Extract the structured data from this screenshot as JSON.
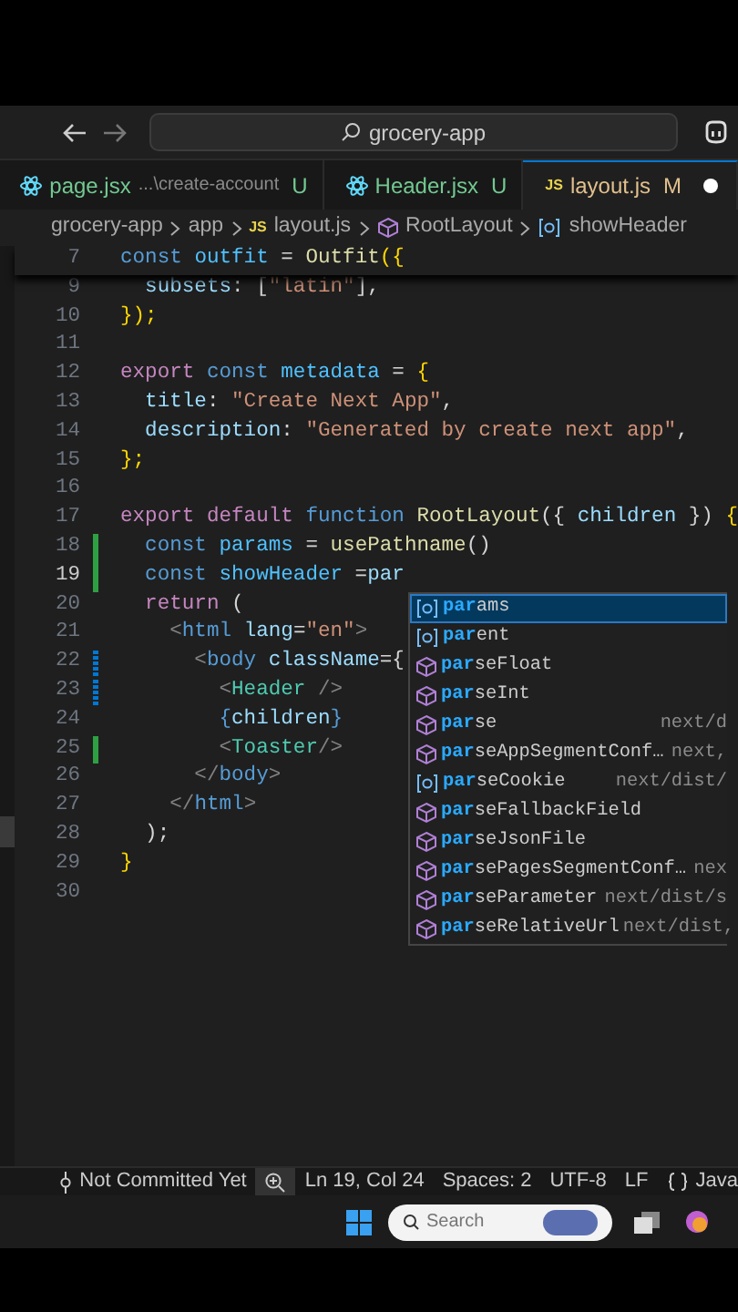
{
  "title_bar": {
    "search": "grocery-app"
  },
  "tabs": [
    {
      "label": "page.jsx",
      "path": "...\\create-account",
      "badge": "U",
      "kind": "react",
      "modified": false,
      "selected": false,
      "dirty": false
    },
    {
      "label": "Header.jsx",
      "badge": "U",
      "kind": "react",
      "modified": false,
      "selected": false,
      "dirty": false
    },
    {
      "label": "layout.js",
      "badge": "M",
      "kind": "js",
      "icon_text": "JS",
      "modified": true,
      "selected": true,
      "dirty": true
    }
  ],
  "breadcrumb": [
    {
      "label": "grocery-app",
      "kind": "folder"
    },
    {
      "label": "app",
      "kind": "folder"
    },
    {
      "label": "layout.js",
      "kind": "js",
      "icon_text": "JS"
    },
    {
      "label": "RootLayout",
      "kind": "module"
    },
    {
      "label": "showHeader",
      "kind": "variable"
    }
  ],
  "editor": {
    "sticky": {
      "number": "7",
      "tokens": [
        {
          "text": "const ",
          "kind": "kw"
        },
        {
          "text": "outfit",
          "kind": "const"
        },
        {
          "text": " = ",
          "kind": "p"
        },
        {
          "text": "Outfit",
          "kind": "fn"
        },
        {
          "text": "({",
          "kind": "br"
        }
      ]
    },
    "lines": [
      {
        "number": "9",
        "current": false,
        "added": false,
        "modified": false,
        "tokens": [
          {
            "text": "  subsets",
            "kind": "var"
          },
          {
            "text": ": [",
            "kind": "p"
          },
          {
            "text": "\"latin\"",
            "kind": "str"
          },
          {
            "text": "],",
            "kind": "p"
          }
        ]
      },
      {
        "number": "10",
        "current": false,
        "added": false,
        "modified": false,
        "tokens": [
          {
            "text": "});",
            "kind": "br"
          }
        ]
      },
      {
        "number": "11",
        "current": false,
        "added": false,
        "modified": false
      },
      {
        "number": "12",
        "current": false,
        "added": false,
        "modified": false,
        "tokens": [
          {
            "text": "export ",
            "kind": "ctl"
          },
          {
            "text": "const ",
            "kind": "kw"
          },
          {
            "text": "metadata",
            "kind": "const"
          },
          {
            "text": " = ",
            "kind": "p"
          },
          {
            "text": "{",
            "kind": "br"
          }
        ]
      },
      {
        "number": "13",
        "current": false,
        "added": false,
        "modified": false,
        "tokens": [
          {
            "text": "  title",
            "kind": "var"
          },
          {
            "text": ": ",
            "kind": "p"
          },
          {
            "text": "\"Create Next App\"",
            "kind": "str"
          },
          {
            "text": ",",
            "kind": "p"
          }
        ]
      },
      {
        "number": "14",
        "current": false,
        "added": false,
        "modified": false,
        "tokens": [
          {
            "text": "  description",
            "kind": "var"
          },
          {
            "text": ": ",
            "kind": "p"
          },
          {
            "text": "\"Generated by create next app\"",
            "kind": "str"
          },
          {
            "text": ",",
            "kind": "p"
          }
        ]
      },
      {
        "number": "15",
        "current": false,
        "added": false,
        "modified": false,
        "tokens": [
          {
            "text": "};",
            "kind": "br"
          }
        ]
      },
      {
        "number": "16",
        "current": false,
        "added": false,
        "modified": false
      },
      {
        "number": "17",
        "current": false,
        "added": false,
        "modified": false,
        "tokens": [
          {
            "text": "export ",
            "kind": "ctl"
          },
          {
            "text": "default ",
            "kind": "ctl"
          },
          {
            "text": "function ",
            "kind": "kw"
          },
          {
            "text": "RootLayout",
            "kind": "fn"
          },
          {
            "text": "({ ",
            "kind": "p"
          },
          {
            "text": "children",
            "kind": "var"
          },
          {
            "text": " }) ",
            "kind": "p"
          },
          {
            "text": "{",
            "kind": "br"
          }
        ]
      },
      {
        "number": "18",
        "current": false,
        "added": true,
        "modified": false,
        "tokens": [
          {
            "text": "  const ",
            "kind": "kw"
          },
          {
            "text": "params",
            "kind": "const"
          },
          {
            "text": " = ",
            "kind": "p"
          },
          {
            "text": "usePathname",
            "kind": "fn"
          },
          {
            "text": "()",
            "kind": "p"
          }
        ]
      },
      {
        "number": "19",
        "current": true,
        "added": true,
        "modified": false,
        "tokens": [
          {
            "text": "  const ",
            "kind": "kw"
          },
          {
            "text": "showHeader",
            "kind": "const"
          },
          {
            "text": " =",
            "kind": "p"
          },
          {
            "text": "par",
            "kind": "var"
          }
        ]
      },
      {
        "number": "20",
        "current": false,
        "added": false,
        "modified": false,
        "tokens": [
          {
            "text": "  return ",
            "kind": "ctl"
          },
          {
            "text": "(",
            "kind": "p"
          }
        ]
      },
      {
        "number": "21",
        "current": false,
        "added": false,
        "modified": false,
        "tokens": [
          {
            "text": "    <",
            "kind": "tagp"
          },
          {
            "text": "html ",
            "kind": "htag"
          },
          {
            "text": "lang",
            "kind": "var"
          },
          {
            "text": "=",
            "kind": "p"
          },
          {
            "text": "\"en\"",
            "kind": "str"
          },
          {
            "text": ">",
            "kind": "tagp"
          }
        ]
      },
      {
        "number": "22",
        "current": false,
        "added": false,
        "modified": true,
        "tokens": [
          {
            "text": "      <",
            "kind": "tagp"
          },
          {
            "text": "body ",
            "kind": "htag"
          },
          {
            "text": "className",
            "kind": "var"
          },
          {
            "text": "={",
            "kind": "p"
          }
        ]
      },
      {
        "number": "23",
        "current": false,
        "added": false,
        "modified": true,
        "tokens": [
          {
            "text": "        <",
            "kind": "tagp"
          },
          {
            "text": "Header",
            "kind": "tag"
          },
          {
            "text": " />",
            "kind": "tagp"
          }
        ]
      },
      {
        "number": "24",
        "current": false,
        "added": false,
        "modified": false,
        "tokens": [
          {
            "text": "        {",
            "kind": "htag"
          },
          {
            "text": "children",
            "kind": "var"
          },
          {
            "text": "}",
            "kind": "htag"
          }
        ]
      },
      {
        "number": "25",
        "current": false,
        "added": true,
        "modified": false,
        "tokens": [
          {
            "text": "        <",
            "kind": "tagp"
          },
          {
            "text": "Toaster",
            "kind": "tag"
          },
          {
            "text": "/>",
            "kind": "tagp"
          }
        ]
      },
      {
        "number": "26",
        "current": false,
        "added": false,
        "modified": false,
        "tokens": [
          {
            "text": "      </",
            "kind": "tagp"
          },
          {
            "text": "body",
            "kind": "htag"
          },
          {
            "text": ">",
            "kind": "tagp"
          }
        ]
      },
      {
        "number": "27",
        "current": false,
        "added": false,
        "modified": false,
        "tokens": [
          {
            "text": "    </",
            "kind": "tagp"
          },
          {
            "text": "html",
            "kind": "htag"
          },
          {
            "text": ">",
            "kind": "tagp"
          }
        ]
      },
      {
        "number": "28",
        "current": false,
        "added": false,
        "modified": false,
        "tokens": [
          {
            "text": "  );",
            "kind": "p"
          }
        ]
      },
      {
        "number": "29",
        "current": false,
        "added": false,
        "modified": false,
        "tokens": [
          {
            "text": "}",
            "kind": "br"
          }
        ]
      },
      {
        "number": "30",
        "current": false,
        "added": false,
        "modified": false
      }
    ],
    "suggestions": [
      {
        "match": "par",
        "rest": "ams",
        "kind": "variable",
        "selected": true
      },
      {
        "match": "par",
        "rest": "ent",
        "kind": "variable",
        "selected": false
      },
      {
        "match": "par",
        "rest": "seFloat",
        "kind": "module",
        "selected": false
      },
      {
        "match": "par",
        "rest": "seInt",
        "kind": "module",
        "selected": false
      },
      {
        "match": "par",
        "rest": "se",
        "detail": "next/d",
        "kind": "module",
        "selected": false
      },
      {
        "match": "par",
        "rest": "seAppSegmentConf…",
        "detail": "next,",
        "kind": "module",
        "selected": false
      },
      {
        "match": "par",
        "rest": "seCookie",
        "detail": "next/dist/",
        "kind": "variable",
        "selected": false
      },
      {
        "match": "par",
        "rest": "seFallbackField",
        "kind": "module",
        "selected": false
      },
      {
        "match": "par",
        "rest": "seJsonFile",
        "kind": "module",
        "selected": false
      },
      {
        "match": "par",
        "rest": "sePagesSegmentConf…",
        "detail": "nex",
        "kind": "module",
        "selected": false
      },
      {
        "match": "par",
        "rest": "seParameter",
        "detail": "next/dist/s",
        "kind": "module",
        "selected": false
      },
      {
        "match": "par",
        "rest": "seRelativeUrl",
        "detail": "next/dist,",
        "kind": "module",
        "selected": false
      }
    ]
  },
  "status_bar": [
    {
      "text": "Not Committed Yet",
      "kind": "git"
    },
    {
      "kind": "zoom"
    },
    {
      "text": "Ln 19, Col 24",
      "kind": "plain"
    },
    {
      "text": "Spaces: 2",
      "kind": "plain"
    },
    {
      "text": "UTF-8",
      "kind": "plain"
    },
    {
      "text": "LF",
      "kind": "plain"
    },
    {
      "text": "Java",
      "kind": "language"
    }
  ],
  "taskbar": {
    "search_placeholder": "Search"
  }
}
